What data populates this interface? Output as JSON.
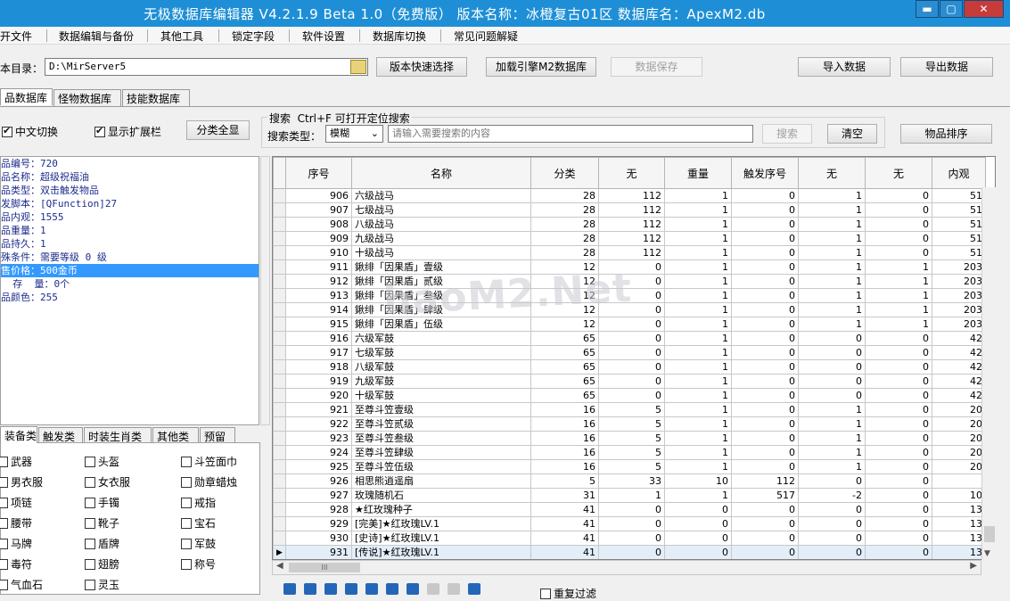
{
  "title": "无极数据库编辑器 V4.2.1.9    Beta 1.0（免费版）    版本名称：冰橙复古01区    数据库名：ApexM2.db",
  "window": {
    "minimize": "▬",
    "maximize": "▢",
    "close": "✕"
  },
  "menu": [
    "开文件",
    "数据编辑与备份",
    "其他工具",
    "锁定字段",
    "软件设置",
    "数据库切换",
    "常见问题解疑"
  ],
  "path": {
    "label": "本目录：",
    "value": "D:\\MirServer5"
  },
  "buttons": {
    "version": "版本快速选择",
    "load": "加载引擎M2数据库",
    "save": "数据保存",
    "import": "导入数据",
    "export": "导出数据"
  },
  "tabs": [
    "品数据库",
    "怪物数据库",
    "技能数据库"
  ],
  "options": {
    "chinese": "中文切换",
    "ext": "显示扩展栏",
    "showall": "分类全显"
  },
  "search": {
    "header": "搜索  Ctrl+F 可打开定位搜索",
    "type_label": "搜索类型：",
    "type_value": "模糊",
    "placeholder": "请输入需要搜索的内容",
    "search_btn": "搜索",
    "clear_btn": "清空",
    "sort_btn": "物品排序"
  },
  "info": [
    "品编号：720",
    "品名称：超级祝福油",
    "品类型：双击触发物品",
    "发脚本：[QFunction]27",
    "品内观：1555",
    "品重量：1",
    "品持久：1",
    "殊条件：需要等级 0 级",
    "售价格：500金币",
    "  存  量：0个",
    "品颜色：255"
  ],
  "cat_tabs": [
    "装备类",
    "触发类",
    "时装生肖类",
    "其他类",
    "预留"
  ],
  "categories": [
    "武器",
    "头盔",
    "斗笠面巾",
    "男衣服",
    "女衣服",
    "勋章蜡烛",
    "项链",
    "手镯",
    "戒指",
    "腰带",
    "靴子",
    "宝石",
    "马牌",
    "盾牌",
    "军鼓",
    "毒符",
    "翅膀",
    "称号",
    "气血石",
    "灵玉"
  ],
  "columns": [
    "序号",
    "名称",
    "分类",
    "无",
    "重量",
    "触发序号",
    "无",
    "无",
    "内观"
  ],
  "rows": [
    [
      "906",
      "六级战马",
      "28",
      "112",
      "1",
      "0",
      "1",
      "0",
      "51"
    ],
    [
      "907",
      "七级战马",
      "28",
      "112",
      "1",
      "0",
      "1",
      "0",
      "51"
    ],
    [
      "908",
      "八级战马",
      "28",
      "112",
      "1",
      "0",
      "1",
      "0",
      "51"
    ],
    [
      "909",
      "九级战马",
      "28",
      "112",
      "1",
      "0",
      "1",
      "0",
      "51"
    ],
    [
      "910",
      "十级战马",
      "28",
      "112",
      "1",
      "0",
      "1",
      "0",
      "51"
    ],
    [
      "911",
      "鍬绯「因果盾」壹级",
      "12",
      "0",
      "1",
      "0",
      "1",
      "1",
      "203"
    ],
    [
      "912",
      "鍬绯「因果盾」贰级",
      "12",
      "0",
      "1",
      "0",
      "1",
      "1",
      "203"
    ],
    [
      "913",
      "鍬绯「因果盾」叁级",
      "12",
      "0",
      "1",
      "0",
      "1",
      "1",
      "203"
    ],
    [
      "914",
      "鍬绯「因果盾」肆级",
      "12",
      "0",
      "1",
      "0",
      "1",
      "1",
      "203"
    ],
    [
      "915",
      "鍬绯「因果盾」伍级",
      "12",
      "0",
      "1",
      "0",
      "1",
      "1",
      "203"
    ],
    [
      "916",
      "六级军鼓",
      "65",
      "0",
      "1",
      "0",
      "0",
      "0",
      "42"
    ],
    [
      "917",
      "七级军鼓",
      "65",
      "0",
      "1",
      "0",
      "0",
      "0",
      "42"
    ],
    [
      "918",
      "八级军鼓",
      "65",
      "0",
      "1",
      "0",
      "0",
      "0",
      "42"
    ],
    [
      "919",
      "九级军鼓",
      "65",
      "0",
      "1",
      "0",
      "0",
      "0",
      "42"
    ],
    [
      "920",
      "十级军鼓",
      "65",
      "0",
      "1",
      "0",
      "0",
      "0",
      "42"
    ],
    [
      "921",
      "至尊斗笠壹级",
      "16",
      "5",
      "1",
      "0",
      "1",
      "0",
      "20"
    ],
    [
      "922",
      "至尊斗笠贰级",
      "16",
      "5",
      "1",
      "0",
      "1",
      "0",
      "20"
    ],
    [
      "923",
      "至尊斗笠叁级",
      "16",
      "5",
      "1",
      "0",
      "1",
      "0",
      "20"
    ],
    [
      "924",
      "至尊斗笠肆级",
      "16",
      "5",
      "1",
      "0",
      "1",
      "0",
      "20"
    ],
    [
      "925",
      "至尊斗笠伍级",
      "16",
      "5",
      "1",
      "0",
      "1",
      "0",
      "20"
    ],
    [
      "926",
      "相思熊逍遥扇",
      "5",
      "33",
      "10",
      "112",
      "0",
      "0",
      ""
    ],
    [
      "927",
      "玫瑰随机石",
      "31",
      "1",
      "1",
      "517",
      "-2",
      "0",
      "10"
    ],
    [
      "928",
      "★红玫瑰种子",
      "41",
      "0",
      "0",
      "0",
      "0",
      "0",
      "13"
    ],
    [
      "929",
      "[完美]★红玫瑰LV.1",
      "41",
      "0",
      "0",
      "0",
      "0",
      "0",
      "13"
    ],
    [
      "930",
      "[史诗]★红玫瑰LV.1",
      "41",
      "0",
      "0",
      "0",
      "0",
      "0",
      "13"
    ],
    [
      "931",
      "[传说]★红玫瑰LV.1",
      "41",
      "0",
      "0",
      "0",
      "0",
      "0",
      "13"
    ]
  ],
  "selected_row": "931",
  "hscroll_thumb": "III",
  "watermark": "haoM2.Net",
  "filter": "重复过滤"
}
